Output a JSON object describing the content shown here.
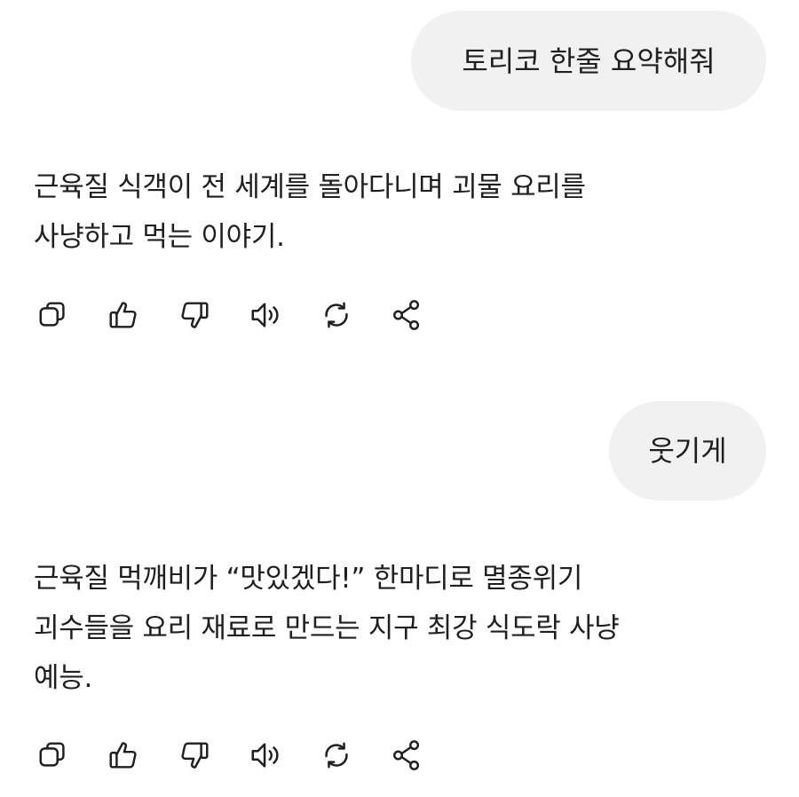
{
  "conversation": [
    {
      "role": "user",
      "text": "토리코 한줄 요약해줘"
    },
    {
      "role": "assistant",
      "lines": [
        "근육질 식객이 전 세계를 돌아다니며 괴물 요리를",
        "사냥하고 먹는 이야기."
      ]
    },
    {
      "role": "user",
      "text": "웃기게"
    },
    {
      "role": "assistant",
      "lines": [
        "근육질 먹깨비가 “맛있겠다!” 한마디로 멸종위기",
        "괴수들을 요리 재료로 만드는 지구 최강 식도락 사냥",
        "예능."
      ]
    }
  ],
  "action_icons": [
    "copy-icon",
    "thumbs-up-icon",
    "thumbs-down-icon",
    "speaker-icon",
    "regenerate-icon",
    "share-icon"
  ]
}
